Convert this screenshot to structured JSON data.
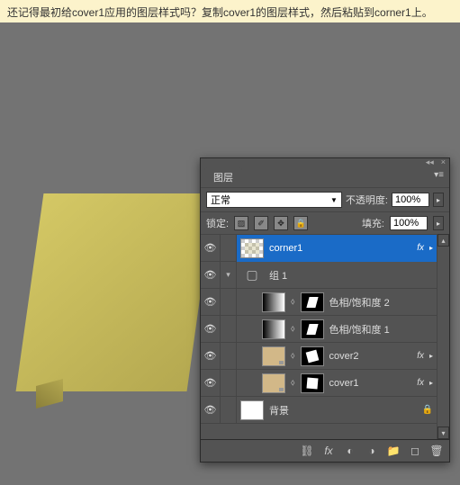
{
  "hint": "还记得最初给cover1应用的图层样式吗？复制cover1的图层样式，然后粘贴到corner1上。",
  "panel": {
    "tab": "图层",
    "menu_icon": "▾≡"
  },
  "blend": {
    "mode": "正常",
    "opacity_label": "不透明度:",
    "opacity": "100%"
  },
  "lock": {
    "label": "锁定:",
    "fill_label": "填充:",
    "fill": "100%"
  },
  "layers": [
    {
      "name": "corner1",
      "fx": true,
      "selected": true,
      "thumb": "checker"
    },
    {
      "name": "组 1",
      "group": true
    },
    {
      "name": "色相/饱和度 2",
      "mask": "m1",
      "thumb": "grad-bw",
      "nested": true
    },
    {
      "name": "色相/饱和度 1",
      "mask": "m1",
      "thumb": "grad-bw",
      "nested": true
    },
    {
      "name": "cover2",
      "fx": true,
      "mask": "m2",
      "thumb": "tan",
      "nested": true
    },
    {
      "name": "cover1",
      "fx": true,
      "mask": "m3",
      "thumb": "tan",
      "nested": true
    },
    {
      "name": "背景",
      "thumb": "white",
      "locked": true
    }
  ],
  "icons": {
    "eye": "👁",
    "triangle_down": "▾",
    "triangle_right": "▸",
    "triangle_dd": "▼",
    "lock": "🔒",
    "brush": "✐",
    "move": "✥",
    "lock2": "🔒",
    "link": "⬨",
    "fx": "fx",
    "chain": "⛓",
    "mask": "◐",
    "adjust": "◑",
    "folder": "📁",
    "new": "◻",
    "trash": "🗑",
    "close": "×",
    "collapse": "◂◂"
  }
}
